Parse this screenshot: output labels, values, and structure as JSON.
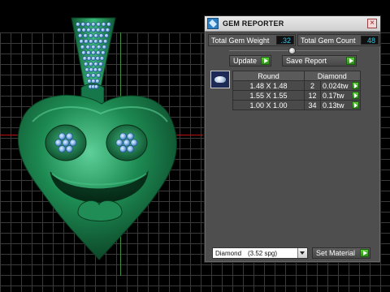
{
  "panel": {
    "title": "GEM REPORTER",
    "close_label": "×"
  },
  "stats": {
    "weight_label": "Total Gem Weight",
    "weight_value": ".32",
    "count_label": "Total Gem Count",
    "count_value": "48"
  },
  "buttons": {
    "update": "Update",
    "save_report": "Save Report",
    "set_material": "Set Material"
  },
  "table": {
    "headers": [
      "Round",
      "Diamond"
    ],
    "rows": [
      {
        "size": "1.48 X 1.48",
        "count": "2",
        "weight": "0.024tw"
      },
      {
        "size": "1.55 X 1.55",
        "count": "12",
        "weight": "0.17tw"
      },
      {
        "size": "1.00 X 1.00",
        "count": "34",
        "weight": "0.13tw"
      }
    ]
  },
  "material": {
    "name": "Diamond",
    "spg": "(3.52 spg)"
  },
  "colors": {
    "model_green": "#1d8a52",
    "gem_blue": "#6fa8e0",
    "value_cyan": "#33c6e6",
    "go_green": "#3fb52a",
    "axis_red": "#b91313"
  }
}
